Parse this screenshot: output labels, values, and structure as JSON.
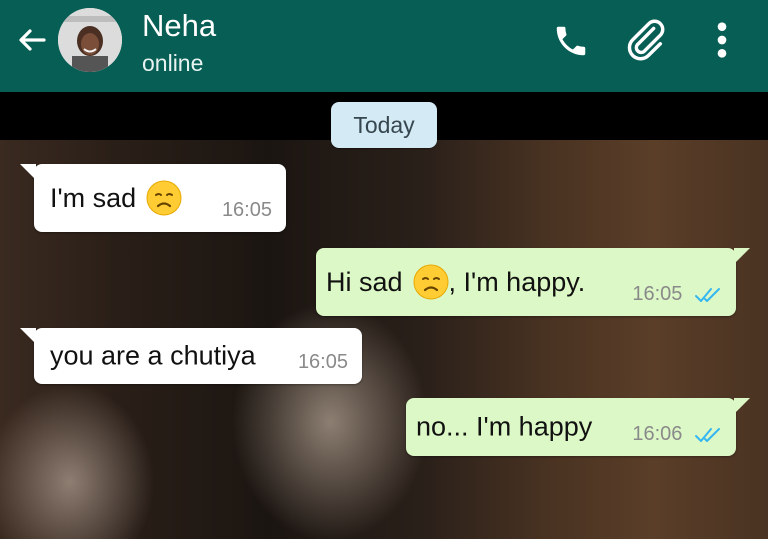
{
  "header": {
    "contact_name": "Neha",
    "contact_status": "online"
  },
  "chat": {
    "date_divider": "Today",
    "messages": [
      {
        "direction": "incoming",
        "text_before": "I'm sad",
        "emoji": "sad-face",
        "text_after": "",
        "time": "16:05"
      },
      {
        "direction": "outgoing",
        "text_before": "Hi sad",
        "emoji": "sad-face",
        "text_after": ", I'm happy.",
        "time": "16:05",
        "read": true
      },
      {
        "direction": "incoming",
        "text_before": "you are a chutiya",
        "time": "16:05"
      },
      {
        "direction": "outgoing",
        "text_before": "no... I'm happy",
        "time": "16:06",
        "read": true
      }
    ]
  },
  "colors": {
    "header_bg": "#075e54",
    "incoming_bg": "#ffffff",
    "outgoing_bg": "#dcf8c6",
    "tick_read": "#34b7f1"
  }
}
